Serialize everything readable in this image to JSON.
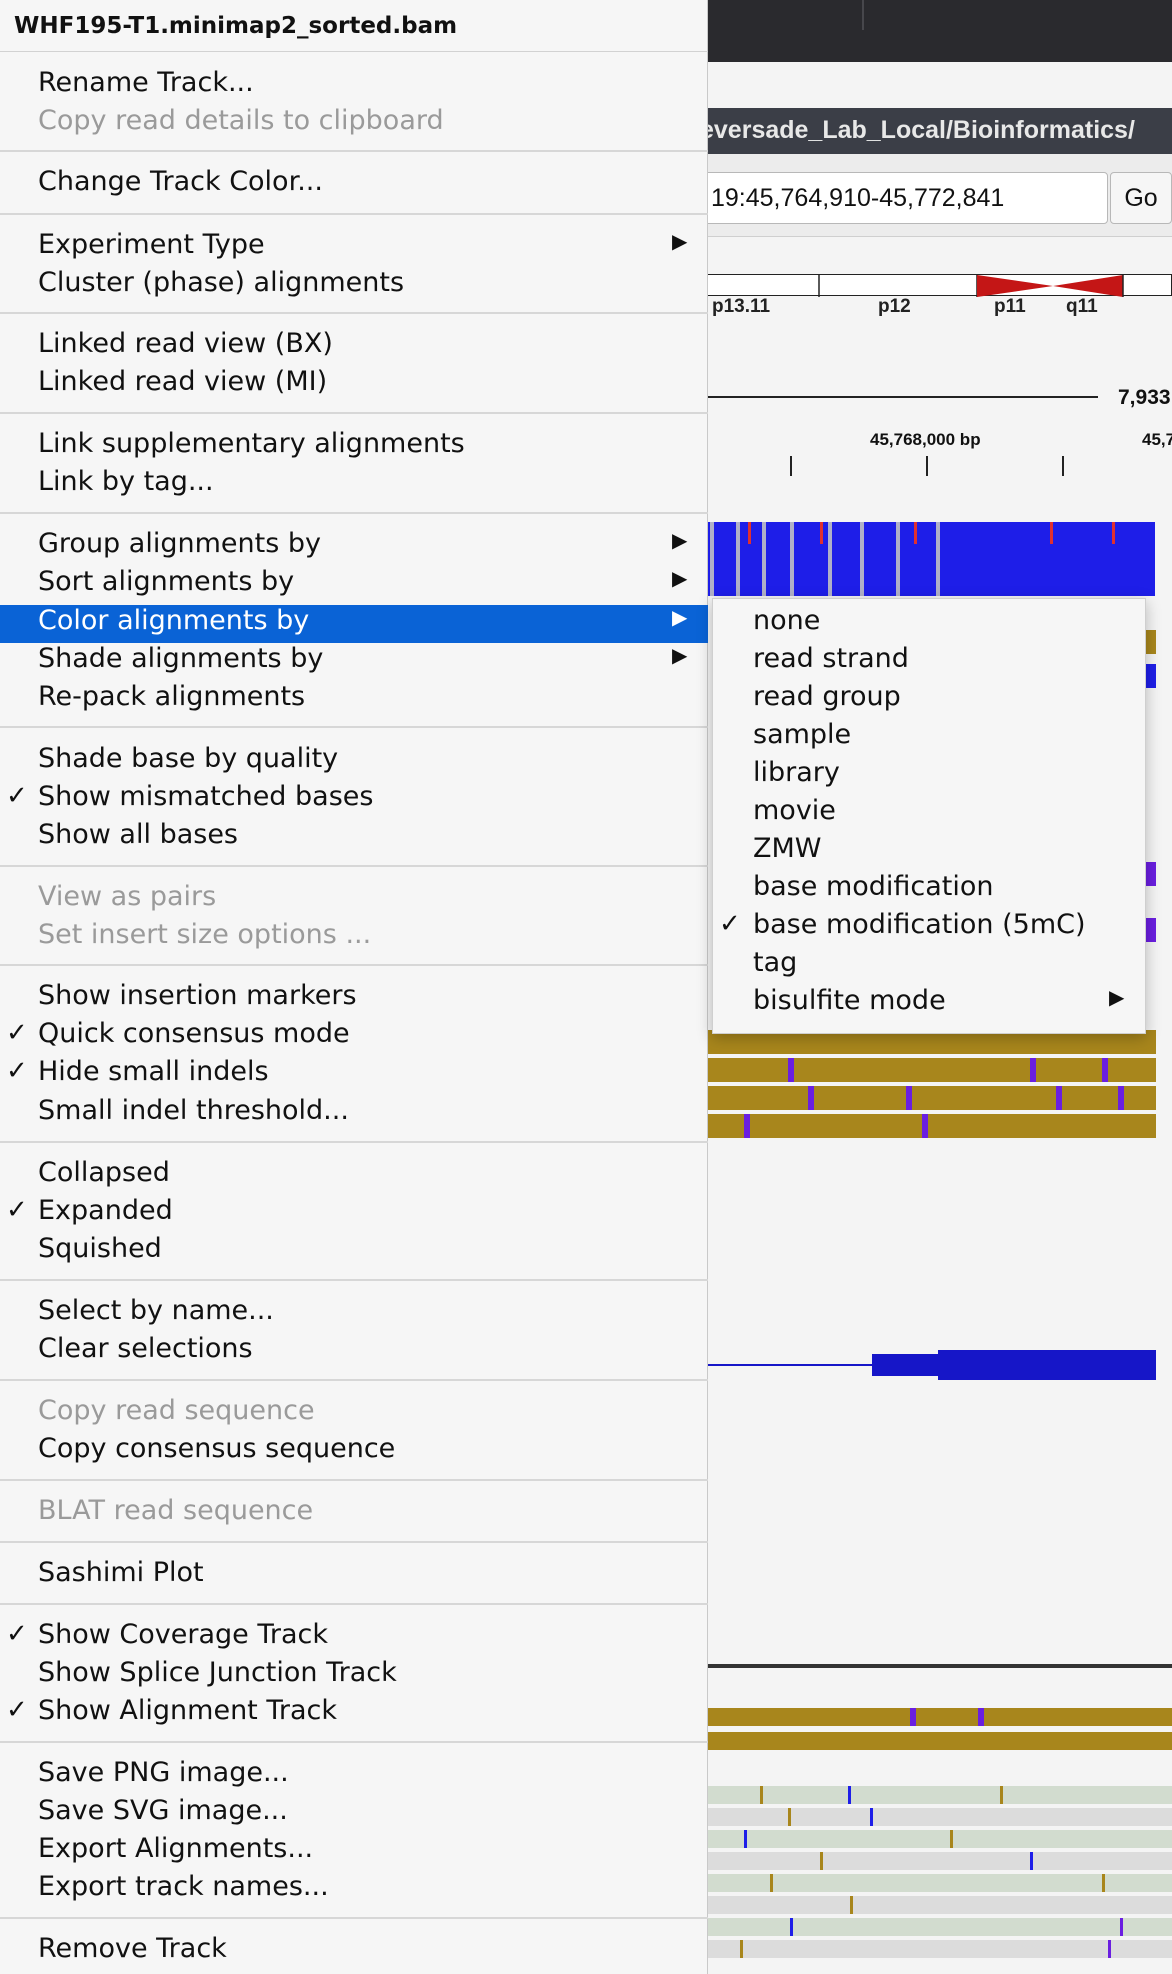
{
  "igv": {
    "path_text": "eversade_Lab_Local/Bioinformatics/",
    "locus": "19:45,764,910-45,772,841",
    "go_label": "Go",
    "bands": [
      "p13.11",
      "p12",
      "p11",
      "q11"
    ],
    "span_label": "7,933",
    "ruler_labels": [
      "45,768,000 bp",
      "45,7"
    ]
  },
  "menu": {
    "title": "WHF195-T1.minimap2_sorted.bam",
    "items": [
      {
        "label": "Rename Track..."
      },
      {
        "label": "Copy read details to clipboard"
      },
      {
        "label": "Change Track Color..."
      },
      {
        "label": "Experiment Type"
      },
      {
        "label": "Cluster (phase) alignments"
      },
      {
        "label": "Linked read view (BX)"
      },
      {
        "label": "Linked read view (MI)"
      },
      {
        "label": "Link supplementary alignments"
      },
      {
        "label": "Link by tag..."
      },
      {
        "label": "Group alignments by"
      },
      {
        "label": "Sort alignments by"
      },
      {
        "label": "Color alignments by"
      },
      {
        "label": "Shade alignments by"
      },
      {
        "label": "Re-pack alignments"
      },
      {
        "label": "Shade base by quality"
      },
      {
        "label": "Show mismatched bases"
      },
      {
        "label": "Show all bases"
      },
      {
        "label": "View as pairs"
      },
      {
        "label": "Set insert size options ..."
      },
      {
        "label": "Show insertion markers"
      },
      {
        "label": "Quick consensus mode"
      },
      {
        "label": "Hide small indels"
      },
      {
        "label": "Small indel threshold..."
      },
      {
        "label": "Collapsed"
      },
      {
        "label": "Expanded"
      },
      {
        "label": "Squished"
      },
      {
        "label": "Select by name..."
      },
      {
        "label": "Clear selections"
      },
      {
        "label": "Copy read sequence"
      },
      {
        "label": "Copy consensus sequence"
      },
      {
        "label": "BLAT read sequence"
      },
      {
        "label": "Sashimi Plot"
      },
      {
        "label": "Show Coverage Track"
      },
      {
        "label": "Show Splice Junction Track"
      },
      {
        "label": "Show Alignment Track"
      },
      {
        "label": "Save PNG image..."
      },
      {
        "label": "Save SVG image..."
      },
      {
        "label": "Export Alignments..."
      },
      {
        "label": "Export track names..."
      },
      {
        "label": "Remove Track"
      }
    ]
  },
  "submenu": {
    "items": [
      {
        "label": "none"
      },
      {
        "label": "read strand"
      },
      {
        "label": "read group"
      },
      {
        "label": "sample"
      },
      {
        "label": "library"
      },
      {
        "label": "movie"
      },
      {
        "label": "ZMW"
      },
      {
        "label": "base modification"
      },
      {
        "label": "base modification (5mC)"
      },
      {
        "label": "tag"
      },
      {
        "label": "bisulfite mode"
      }
    ]
  },
  "glyphs": {
    "check": "✓",
    "arrow": "▶"
  },
  "colors": {
    "highlight": "#0a63d6",
    "coverage": "#1e1ee8",
    "methylation": "#a8861c",
    "modification": "#6a1ee0"
  }
}
